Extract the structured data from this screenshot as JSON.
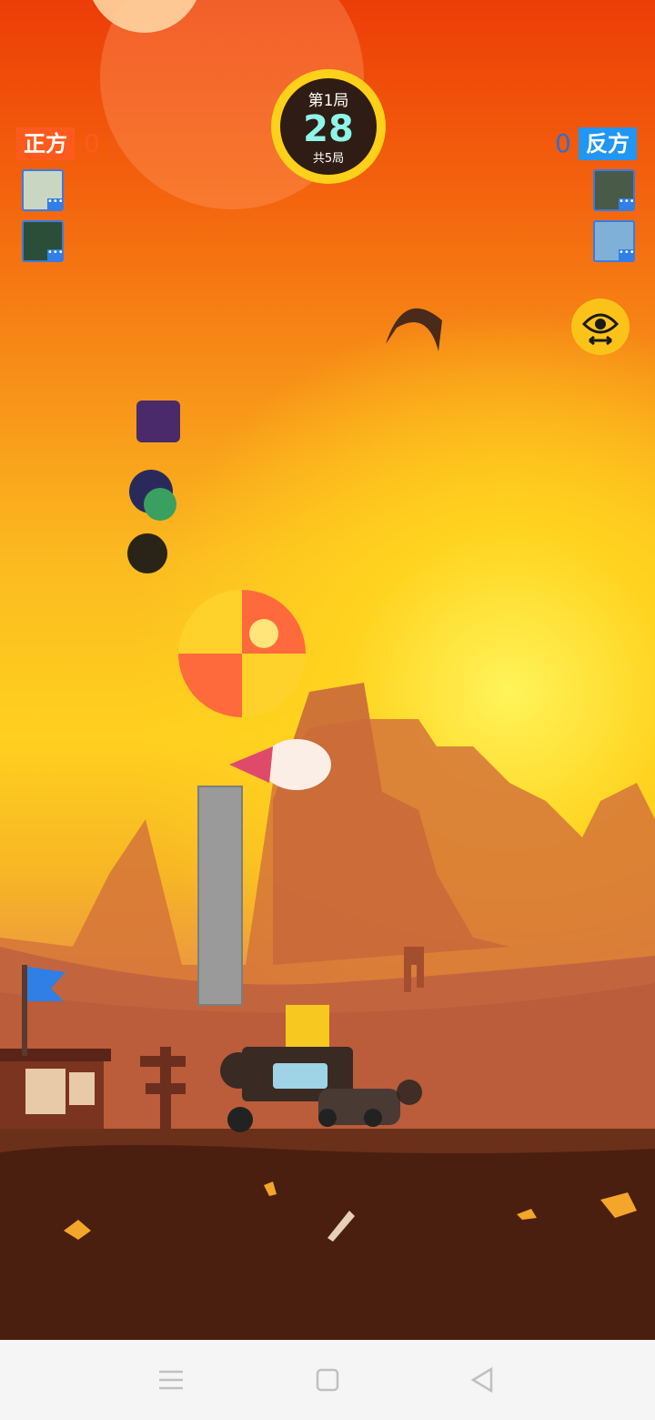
{
  "left_team": {
    "label": "正方",
    "score": "0"
  },
  "right_team": {
    "label": "反方",
    "score": "0"
  },
  "round": {
    "current": "第1局",
    "seconds": "28",
    "total": "共5局"
  },
  "avatar_badge": "•••",
  "colors": {
    "left_team": "#ff5a1e",
    "right_team": "#2196f3",
    "timer_ring": "#fdd019"
  },
  "icons": {
    "view_toggle": "eye-swap-icon",
    "nav_menu": "menu-icon",
    "nav_home": "home-square-icon",
    "nav_back": "back-triangle-icon"
  }
}
